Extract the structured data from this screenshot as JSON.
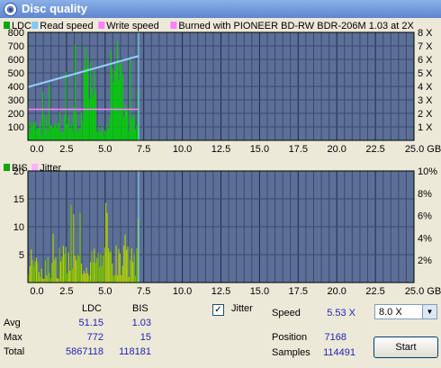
{
  "window": {
    "title": "Disc quality",
    "icon": "disc-icon"
  },
  "top_chart": {
    "legend": [
      {
        "label": "LDC",
        "color": "#00a800"
      },
      {
        "label": "Read speed",
        "color": "#80c8ff"
      },
      {
        "label": "Write speed",
        "color": "#ff80ff"
      },
      {
        "label": "Burned with PIONEER BD-RW   BDR-206M 1.03 at 2X",
        "color": "#ff80ff"
      }
    ],
    "y_ticks": [
      "800",
      "700",
      "600",
      "500",
      "400",
      "300",
      "200",
      "100"
    ],
    "y2_ticks": [
      "8 X",
      "7 X",
      "6 X",
      "5 X",
      "4 X",
      "3 X",
      "2 X",
      "1 X"
    ],
    "x_ticks": [
      "0.0",
      "2.5",
      "5.0",
      "7.5",
      "10.0",
      "12.5",
      "15.0",
      "17.5",
      "20.0",
      "22.5",
      "25.0 GB"
    ]
  },
  "bottom_chart": {
    "legend": [
      {
        "label": "BIS",
        "color": "#00a800"
      },
      {
        "label": "Jitter",
        "color": "#ffb0ff"
      }
    ],
    "y_ticks": [
      "20",
      "15",
      "10",
      "5"
    ],
    "y2_ticks": [
      "10%",
      "8%",
      "6%",
      "4%",
      "2%"
    ],
    "x_ticks": [
      "0.0",
      "2.5",
      "5.0",
      "7.5",
      "10.0",
      "12.5",
      "15.0",
      "17.5",
      "20.0",
      "22.5",
      "25.0 GB"
    ]
  },
  "chart_data": [
    {
      "type": "bar",
      "title": "",
      "xlabel": "GB",
      "xlim": [
        0,
        25
      ],
      "ylim": [
        0,
        800
      ],
      "y2lim": [
        0,
        8
      ],
      "series": [
        {
          "name": "LDC",
          "x_end": 7.17,
          "peak": 772,
          "avg": 51.15
        },
        {
          "name": "Read speed",
          "x": [
            0,
            7.17
          ],
          "values": [
            3.95,
            6.25
          ],
          "axis": "y2"
        },
        {
          "name": "Write speed",
          "x": [
            0,
            7.17
          ],
          "values": [
            2.3,
            2.3
          ],
          "axis": "y2"
        }
      ]
    },
    {
      "type": "bar",
      "title": "",
      "xlabel": "GB",
      "xlim": [
        0,
        25
      ],
      "ylim": [
        0,
        20
      ],
      "y2lim": [
        0,
        10
      ],
      "series": [
        {
          "name": "BIS",
          "x_end": 7.17,
          "peak": 15,
          "avg": 1.03
        },
        {
          "name": "Jitter",
          "values": []
        }
      ]
    }
  ],
  "stats": {
    "col_ldc": "LDC",
    "col_bis": "BIS",
    "rows": [
      {
        "label": "Avg",
        "ldc": "51.15",
        "bis": "1.03"
      },
      {
        "label": "Max",
        "ldc": "772",
        "bis": "15"
      },
      {
        "label": "Total",
        "ldc": "5867118",
        "bis": "118181"
      }
    ]
  },
  "jitter_checkbox": {
    "label": "Jitter",
    "checked": true
  },
  "info": {
    "speed_label": "Speed",
    "speed_value": "5.53 X",
    "position_label": "Position",
    "position_value": "7168",
    "samples_label": "Samples",
    "samples_value": "114491"
  },
  "speed_select": {
    "value": "8.0 X"
  },
  "start_button": {
    "label": "Start"
  }
}
